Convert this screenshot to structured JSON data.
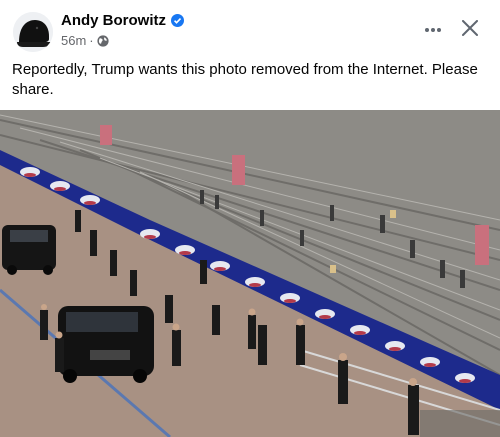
{
  "post": {
    "author": "Andy Borowitz",
    "time": "56m",
    "separator": "·",
    "text": "Reportedly, Trump wants this photo removed from the Internet. Please share.",
    "visibility_icon": "globe-icon",
    "verified_icon": "verified-badge-icon"
  },
  "actions": {
    "more_icon": "more-options-icon",
    "close_icon": "close-icon"
  },
  "colors": {
    "verified_blue": "#1877f2",
    "secondary_text": "#65676b",
    "stand_blue": "#1d2a8c"
  }
}
